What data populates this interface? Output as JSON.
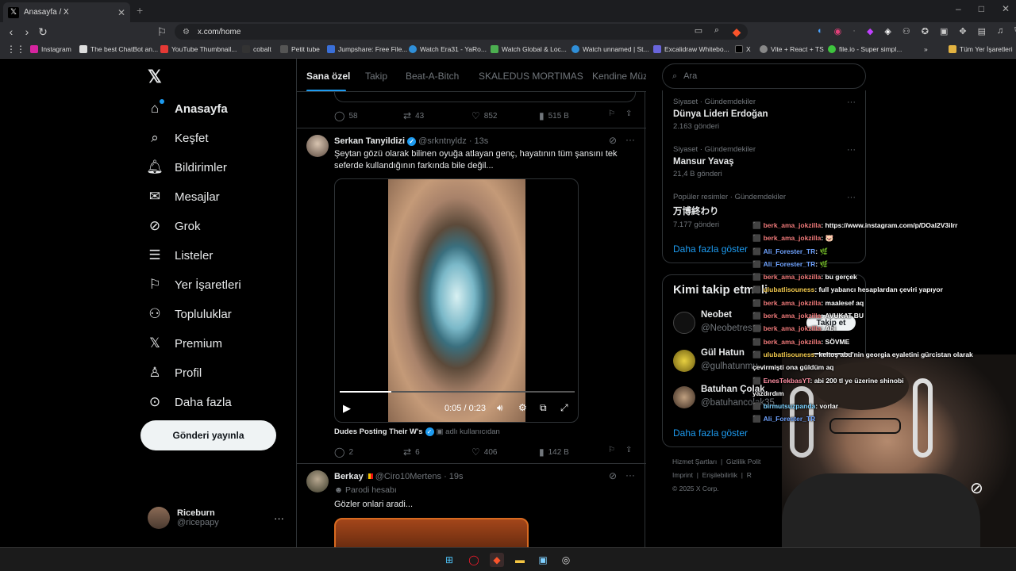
{
  "browser": {
    "tab_title": "Anasayfa / X",
    "url": "x.com/home",
    "bookmarks": [
      "Instagram",
      "The best ChatBot an...",
      "YouTube Thumbnail...",
      "cobalt",
      "Petit tube",
      "Jumpshare: Free File...",
      "Watch Era31 - YaRo...",
      "Watch Global & Loc...",
      "Watch unnamed | St...",
      "Excalidraw Whitebo...",
      "X",
      "Vite + React + TS",
      "file.io - Super simpl..."
    ],
    "all_bookmarks": "Tüm Yer İşaretleri"
  },
  "sidebar": {
    "items": [
      {
        "label": "Anasayfa"
      },
      {
        "label": "Keşfet"
      },
      {
        "label": "Bildirimler"
      },
      {
        "label": "Mesajlar"
      },
      {
        "label": "Grok"
      },
      {
        "label": "Listeler"
      },
      {
        "label": "Yer İşaretleri"
      },
      {
        "label": "Topluluklar"
      },
      {
        "label": "Premium"
      },
      {
        "label": "Profil"
      },
      {
        "label": "Daha fazla"
      }
    ],
    "post_button": "Gönderi yayınla",
    "profile": {
      "name": "Riceburn",
      "handle": "@ricepapy"
    }
  },
  "timeline": {
    "tabs": [
      "Sana özel",
      "Takip",
      "Beat-A-Bitch",
      "SKALEDUS MORTIMAS",
      "Kendine Müz"
    ],
    "prev_actions": {
      "replies": "58",
      "reposts": "43",
      "likes": "852",
      "views": "515 B"
    },
    "tweet1": {
      "name": "Serkan Tanyildizi",
      "handle": "@srkntnyldz",
      "time": "· 13s",
      "text": "Şeytan gözü olarak bilinen oyuğa atlayan genç, hayatının tüm şansını tek seferde kullandığının farkında bile değil...",
      "video_time": "0:05 / 0:23",
      "video_progress": 0.22,
      "source_name": "Dudes Posting Their W's",
      "source_note": "adlı kullanıcıdan",
      "replies": "2",
      "reposts": "6",
      "likes": "406",
      "views": "142 B"
    },
    "tweet2": {
      "name": "Berkay",
      "handle": "@Ciro10Mertens",
      "time": "· 19s",
      "label": "Parodi hesabı",
      "text": "Gözler onlari aradi..."
    }
  },
  "right": {
    "search_placeholder": "Ara",
    "trends": [
      {
        "category": "Siyaset · Gündemdekiler",
        "title": "Dünya Lideri Erdoğan",
        "count": "2.163 gönderi"
      },
      {
        "category": "Siyaset · Gündemdekiler",
        "title": "Mansur Yavaş",
        "count": "21,4 B gönderi"
      },
      {
        "category": "Popüler resimler · Gündemdekiler",
        "title": "万博終わり",
        "count": "7.177 gönderi"
      }
    ],
    "show_more": "Daha fazla göster",
    "who_title": "Kimi takip etmeli",
    "who": [
      {
        "name": "Neobet",
        "handle": "@Neobetresmi"
      },
      {
        "name": "Gül Hatun",
        "handle": "@gulhatunmu"
      },
      {
        "name": "Batuhan Çolak",
        "handle": "@batuhancolak35"
      }
    ],
    "follow_label": "Takip et",
    "footer": [
      "Hizmet Şartları",
      "Gizlilik Polit",
      "Imprint",
      "Erişilebilirlik",
      "R",
      "© 2025 X Corp."
    ]
  },
  "chat": [
    {
      "user": "berk_ama_jokzilla",
      "msg": ": https://www.instagram.com/p/DOal2V3iIrr",
      "cls": "u1"
    },
    {
      "user": "berk_ama_jokzilla",
      "msg": ": 🐷",
      "cls": "u1"
    },
    {
      "user": "Ali_Forester_TR",
      "msg": ": 🌿",
      "cls": "u2"
    },
    {
      "user": "Ali_Forester_TR",
      "msg": ": 🌿",
      "cls": "u2"
    },
    {
      "user": "berk_ama_jokzilla",
      "msg": ": bu gerçek",
      "cls": "u1"
    },
    {
      "user": "ulubatlisouness",
      "msg": ": full yabancı hesaplardan çeviri yapıyor",
      "cls": "u3"
    },
    {
      "user": "berk_ama_jokzilla",
      "msg": ": maalesef aq",
      "cls": "u1"
    },
    {
      "user": "berk_ama_jokzilla",
      "msg": ": AVUKAT BU",
      "cls": "u1"
    },
    {
      "user": "berk_ama_jokzilla",
      "msg": ": Abi",
      "cls": "u1"
    },
    {
      "user": "berk_ama_jokzilla",
      "msg": ": SÖVME",
      "cls": "u1"
    },
    {
      "user": "ulubatlisouness",
      "msg": ": keltoş abd'nin georgia eyaletini gürcistan olarak",
      "cls": "u3"
    },
    {
      "user": "",
      "msg": "çevirmişti ona güldüm aq",
      "cls": "u3"
    },
    {
      "user": "EnesTekbasYT",
      "msg": ": abi 200 tl ye üzerine shinobi",
      "cls": "u4"
    },
    {
      "user": "",
      "msg": "yazdırdım",
      "cls": "u4"
    },
    {
      "user": "birmutsuzpanda",
      "msg": ": vorlar",
      "cls": "u5"
    },
    {
      "user": "Ali_Forester_TR",
      "msg": "",
      "cls": "u2"
    }
  ],
  "colors": {
    "accent": "#1d9bf0",
    "bg": "#000000",
    "border": "#2f3336",
    "muted": "#71767b"
  }
}
